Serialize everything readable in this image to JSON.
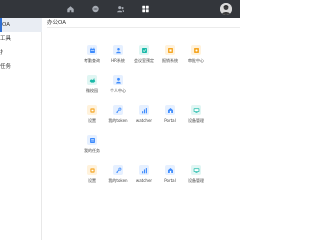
{
  "colors": {
    "topbar": "#33363b",
    "accent": "#2f6fd1"
  },
  "topbar": {
    "icons": [
      "home-icon",
      "message-icon",
      "contacts-icon",
      "apps-grid-icon"
    ],
    "active_icon": "apps-grid-icon"
  },
  "sidebar": {
    "items": [
      {
        "label": "OA",
        "active": true
      },
      {
        "label": "工具",
        "active": false
      },
      {
        "label": "扌",
        "active": false
      },
      {
        "label": "任务",
        "active": false
      }
    ]
  },
  "main": {
    "title": "办公OA"
  },
  "apps": [
    {
      "label": "考勤查询",
      "icon": "calendar-icon",
      "color": "#3d8bfd",
      "bg": "#e6f0ff"
    },
    {
      "label": "HR系统",
      "icon": "users-icon",
      "color": "#3d8bfd",
      "bg": "#e6f0ff"
    },
    {
      "label": "会议室预定",
      "icon": "meeting-icon",
      "color": "#18b9a8",
      "bg": "#e0f6f3"
    },
    {
      "label": "报销系统",
      "icon": "receipt-icon",
      "color": "#f5a623",
      "bg": "#fff2dc"
    },
    {
      "label": "审批中心",
      "icon": "approval-icon",
      "color": "#f5a623",
      "bg": "#fff2dc"
    },
    {
      "label": "微校园",
      "icon": "campus-icon",
      "color": "#18b9a8",
      "bg": "#e0f6f3"
    },
    {
      "label": "个人中心",
      "icon": "person-icon",
      "color": "#3d8bfd",
      "bg": "#e6f0ff"
    },
    {
      "label": "设置",
      "icon": "gear-icon",
      "color": "#f5a623",
      "bg": "#fff2dc"
    },
    {
      "label": "我的token",
      "icon": "key-icon",
      "color": "#3d8bfd",
      "bg": "#e6f0ff"
    },
    {
      "label": "watcher",
      "icon": "bar-chart-icon",
      "color": "#3d8bfd",
      "bg": "#e6f0ff"
    },
    {
      "label": "Portal",
      "icon": "portal-icon",
      "color": "#3d8bfd",
      "bg": "#e6f0ff"
    },
    {
      "label": "设备管理",
      "icon": "device-icon",
      "color": "#18b9a8",
      "bg": "#e0f6f3"
    },
    {
      "label": "我的任务",
      "icon": "task-icon",
      "color": "#3d8bfd",
      "bg": "#e6f0ff"
    },
    {
      "label": "设置",
      "icon": "gear-icon",
      "color": "#f5a623",
      "bg": "#fff2dc"
    },
    {
      "label": "我的token",
      "icon": "key-icon",
      "color": "#3d8bfd",
      "bg": "#e6f0ff"
    },
    {
      "label": "watcher",
      "icon": "bar-chart-icon",
      "color": "#3d8bfd",
      "bg": "#e6f0ff"
    },
    {
      "label": "Portal",
      "icon": "portal-icon",
      "color": "#3d8bfd",
      "bg": "#e6f0ff"
    },
    {
      "label": "设备管理",
      "icon": "device-icon",
      "color": "#18b9a8",
      "bg": "#e0f6f3"
    }
  ]
}
